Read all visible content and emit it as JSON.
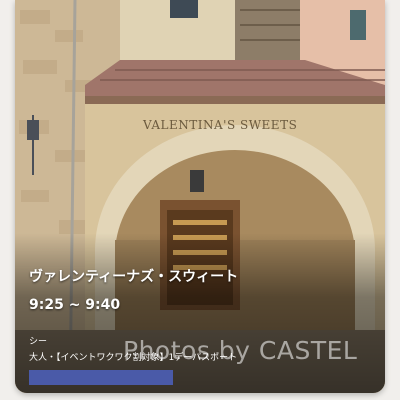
{
  "card": {
    "title": "ヴァレンティーナズ・スウィート",
    "hours": "9:25 ~ 9:40",
    "park": "シー",
    "ticket": "大人・【イベントワクワク割対象】1デーパスポート"
  },
  "photo": {
    "sign_text": "VALENTINA'S SWEETS",
    "watermark": "Photos by CASTEL"
  },
  "colors": {
    "accent_bar": "#4a5aa8",
    "wall": "#d8c49c",
    "roof": "#a0756a"
  }
}
